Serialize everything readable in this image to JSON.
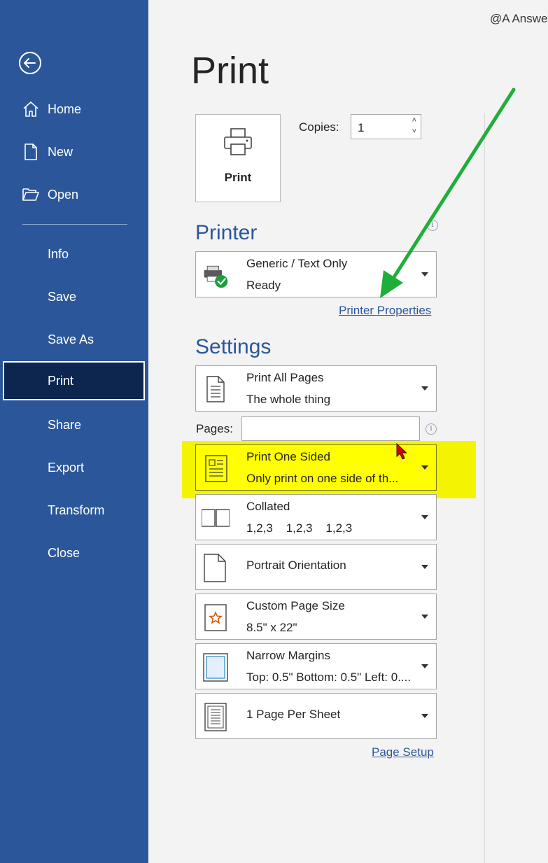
{
  "watermark": "@A Answe",
  "sidebar": {
    "nav_top": [
      {
        "label": "Home",
        "icon": "home-icon"
      },
      {
        "label": "New",
        "icon": "new-document-icon"
      },
      {
        "label": "Open",
        "icon": "folder-open-icon"
      }
    ],
    "nav_bottom": [
      {
        "label": "Info"
      },
      {
        "label": "Save"
      },
      {
        "label": "Save As"
      },
      {
        "label": "Print"
      },
      {
        "label": "Share"
      },
      {
        "label": "Export"
      },
      {
        "label": "Transform"
      },
      {
        "label": "Close"
      }
    ],
    "active": "Print",
    "bg_color": "#2b579a",
    "active_color": "#0c2650"
  },
  "main": {
    "title": "Print",
    "print_button_label": "Print",
    "copies_label": "Copies:",
    "copies_value": "1",
    "printer_heading": "Printer",
    "printer": {
      "name": "Generic / Text Only",
      "status": "Ready"
    },
    "printer_properties_link": "Printer Properties",
    "settings_heading": "Settings",
    "settings": [
      {
        "title": "Print All Pages",
        "subtitle": "The whole thing",
        "icon": "document-pages-icon"
      },
      {
        "title": "Print One Sided",
        "subtitle": "Only print on one side of th...",
        "icon": "one-sided-icon"
      },
      {
        "title": "Collated",
        "subtitle": "1,2,3    1,2,3    1,2,3",
        "icon": "collated-icon"
      },
      {
        "title": "Portrait Orientation",
        "subtitle": "",
        "icon": "portrait-icon"
      },
      {
        "title": "Custom Page Size",
        "subtitle": "8.5\" x 22\"",
        "icon": "page-size-icon"
      },
      {
        "title": "Narrow Margins",
        "subtitle": "Top: 0.5\" Bottom: 0.5\" Left: 0....",
        "icon": "margins-icon"
      },
      {
        "title": "1 Page Per Sheet",
        "subtitle": "",
        "icon": "pages-per-sheet-icon"
      }
    ],
    "pages_label": "Pages:",
    "pages_value": "",
    "page_setup_link": "Page Setup",
    "accent_color": "#2b579a",
    "highlight_color": "#ffff00",
    "annotation_arrow_color": "#1fae3a"
  }
}
